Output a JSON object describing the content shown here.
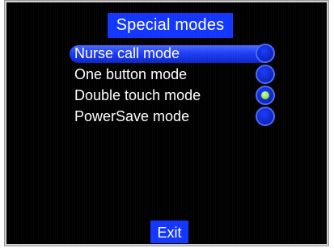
{
  "title": "Special modes",
  "menu": {
    "items": [
      {
        "label": "Nurse call mode",
        "selected": true,
        "checked": false
      },
      {
        "label": "One button mode",
        "selected": false,
        "checked": false
      },
      {
        "label": "Double touch mode",
        "selected": false,
        "checked": true
      },
      {
        "label": "PowerSave mode",
        "selected": false,
        "checked": false
      }
    ]
  },
  "exit_label": "Exit",
  "colors": {
    "screen_bg": "#000000",
    "accent": "#1236ff",
    "radio_check": "#8ee04a"
  }
}
